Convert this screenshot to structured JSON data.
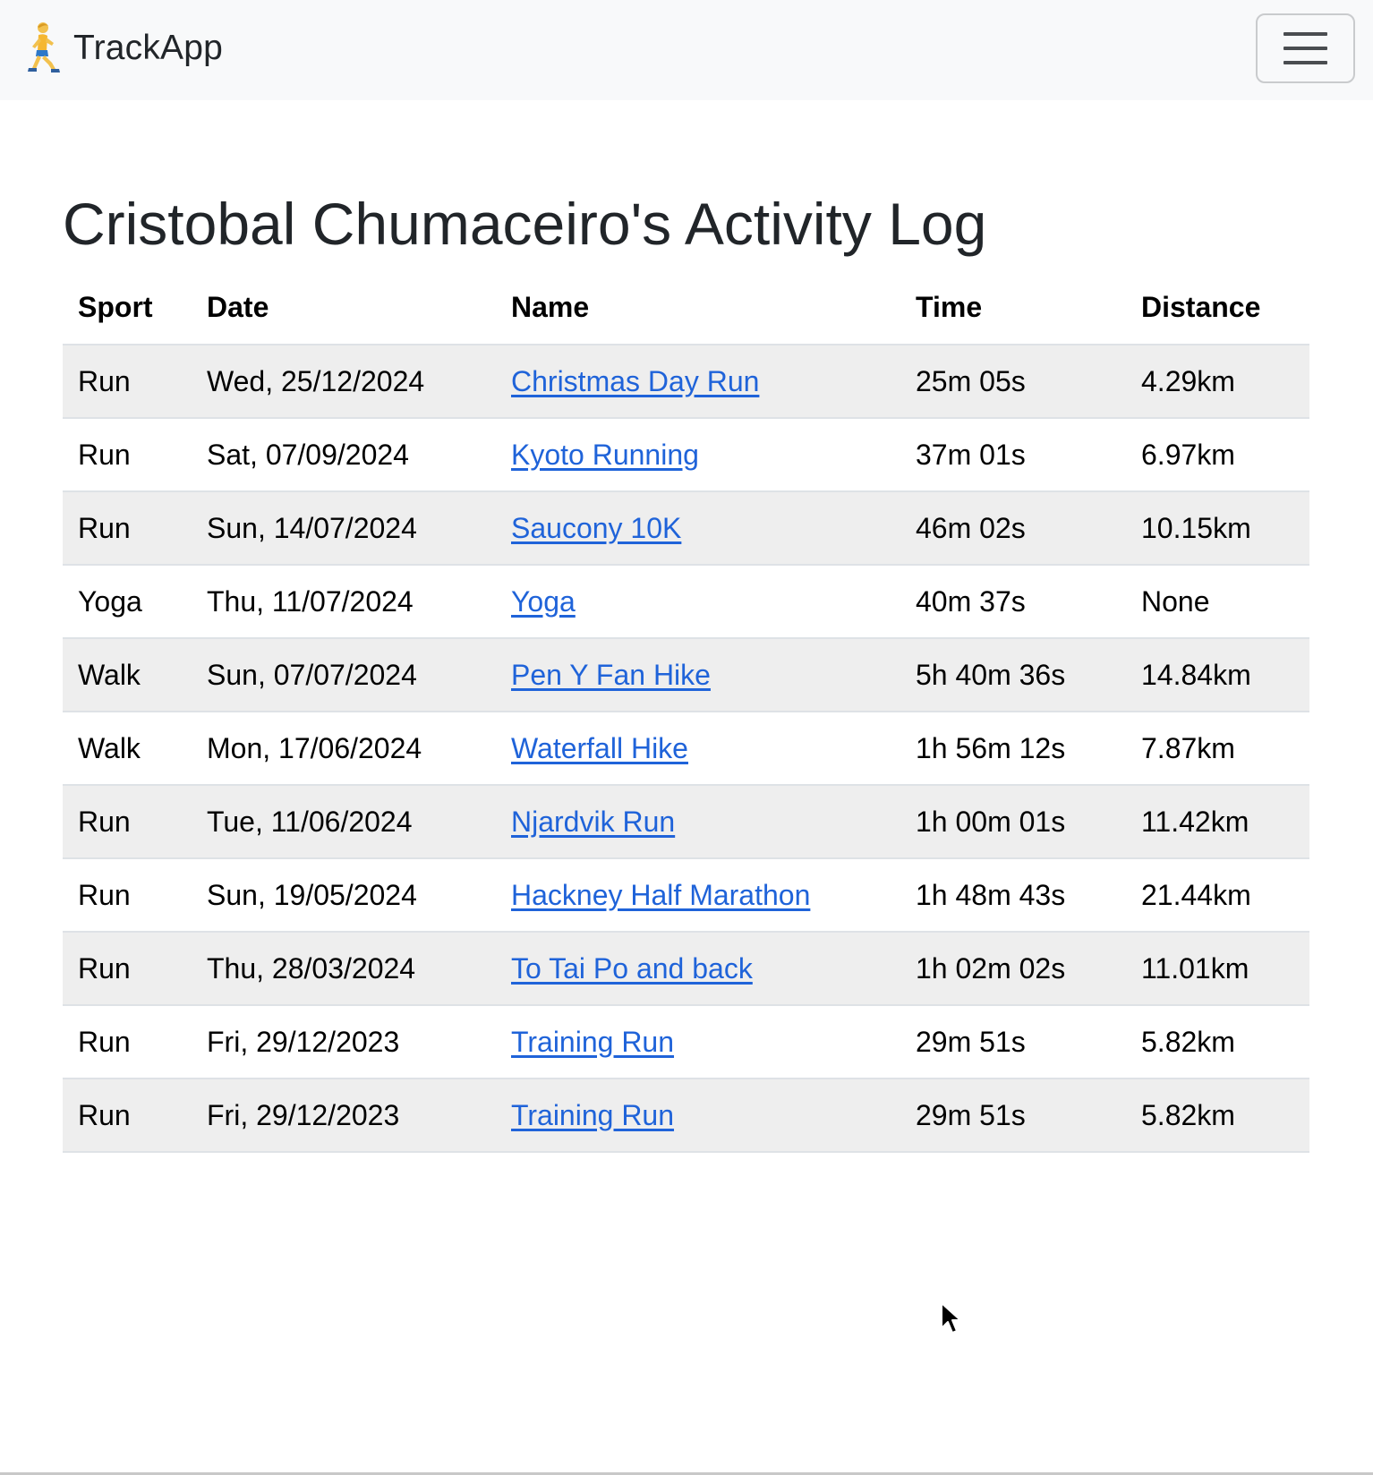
{
  "navbar": {
    "brand_icon": "runner-emoji-icon",
    "brand_text": "TrackApp",
    "toggler_icon": "hamburger-menu-icon"
  },
  "page": {
    "title": "Cristobal Chumaceiro's Activity Log"
  },
  "table": {
    "headers": [
      "Sport",
      "Date",
      "Name",
      "Time",
      "Distance"
    ],
    "rows": [
      {
        "sport": "Run",
        "date": "Wed, 25/12/2024",
        "name": "Christmas Day Run",
        "time": "25m 05s",
        "distance": "4.29km"
      },
      {
        "sport": "Run",
        "date": "Sat, 07/09/2024",
        "name": "Kyoto Running",
        "time": "37m 01s",
        "distance": "6.97km"
      },
      {
        "sport": "Run",
        "date": "Sun, 14/07/2024",
        "name": "Saucony 10K",
        "time": "46m 02s",
        "distance": "10.15km"
      },
      {
        "sport": "Yoga",
        "date": "Thu, 11/07/2024",
        "name": "Yoga",
        "time": "40m 37s",
        "distance": "None"
      },
      {
        "sport": "Walk",
        "date": "Sun, 07/07/2024",
        "name": "Pen Y Fan Hike",
        "time": "5h 40m 36s",
        "distance": "14.84km"
      },
      {
        "sport": "Walk",
        "date": "Mon, 17/06/2024",
        "name": "Waterfall Hike",
        "time": "1h 56m 12s",
        "distance": "7.87km"
      },
      {
        "sport": "Run",
        "date": "Tue, 11/06/2024",
        "name": "Njardvik Run",
        "time": "1h 00m 01s",
        "distance": "11.42km"
      },
      {
        "sport": "Run",
        "date": "Sun, 19/05/2024",
        "name": "Hackney Half Marathon",
        "time": "1h 48m 43s",
        "distance": "21.44km"
      },
      {
        "sport": "Run",
        "date": "Thu, 28/03/2024",
        "name": "To Tai Po and back",
        "time": "1h 02m 02s",
        "distance": "11.01km"
      },
      {
        "sport": "Run",
        "date": "Fri, 29/12/2023",
        "name": "Training Run",
        "time": "29m 51s",
        "distance": "5.82km"
      },
      {
        "sport": "Run",
        "date": "Fri, 29/12/2023",
        "name": "Training Run",
        "time": "29m 51s",
        "distance": "5.82km"
      }
    ]
  },
  "colors": {
    "navbar_bg": "#f8f9fa",
    "link": "#1f63d9",
    "stripe": "#eeeeee",
    "text": "#212529"
  }
}
